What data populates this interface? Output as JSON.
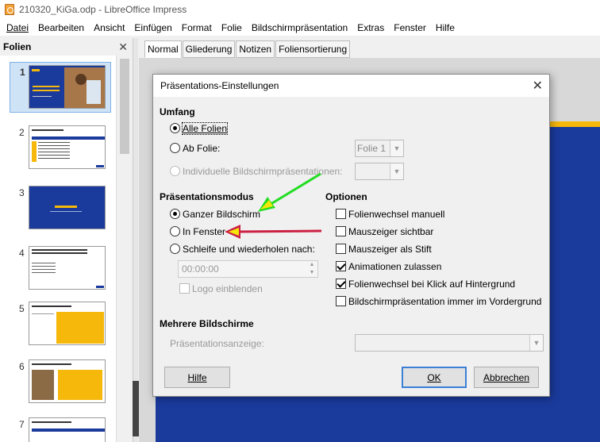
{
  "window": {
    "title": "210320_KiGa.odp - LibreOffice Impress"
  },
  "menu": [
    "Datei",
    "Bearbeiten",
    "Ansicht",
    "Einfügen",
    "Format",
    "Folie",
    "Bildschirmpräsentation",
    "Extras",
    "Fenster",
    "Hilfe"
  ],
  "panel": {
    "title": "Folien",
    "close": "✕"
  },
  "slides": [
    {
      "num": "1"
    },
    {
      "num": "2"
    },
    {
      "num": "3"
    },
    {
      "num": "4"
    },
    {
      "num": "5"
    },
    {
      "num": "6"
    },
    {
      "num": "7"
    }
  ],
  "tabs": [
    "Normal",
    "Gliederung",
    "Notizen",
    "Foliensortierung"
  ],
  "dialog": {
    "title": "Präsentations-Einstellungen",
    "close": "✕",
    "range_heading": "Umfang",
    "range_all": "Alle Folien",
    "range_from": "Ab Folie:",
    "range_from_value": "Folie 1",
    "range_custom": "Individuelle Bildschirmpräsentationen:",
    "mode_heading": "Präsentationsmodus",
    "mode_fullscreen": "Ganzer Bildschirm",
    "mode_window": "In Fenster",
    "mode_loop": "Schleife und wiederholen nach:",
    "loop_time": "00:00:00",
    "show_logo": "Logo einblenden",
    "options_heading": "Optionen",
    "opt_manual": "Folienwechsel manuell",
    "opt_pointer_visible": "Mauszeiger sichtbar",
    "opt_pointer_pen": "Mauszeiger als Stift",
    "opt_animations": "Animationen zulassen",
    "opt_click_bg": "Folienwechsel bei Klick auf Hintergrund",
    "opt_foreground": "Bildschirmpräsentation immer im Vordergrund",
    "multi_heading": "Mehrere Bildschirme",
    "display_label": "Präsentationsanzeige:",
    "display_value": "",
    "help_button": "Hilfe",
    "ok_button": "OK",
    "cancel_button": "Abbrechen"
  },
  "state": {
    "range": "all",
    "mode": "fullscreen",
    "options_checked": [
      "animations",
      "click_bg"
    ]
  },
  "colors": {
    "slide_blue": "#1a3a9c",
    "slide_yellow": "#f5b80b",
    "arrow_green": "#22dd22",
    "arrow_red": "#cc2244",
    "accent": "#3b7fd6"
  }
}
